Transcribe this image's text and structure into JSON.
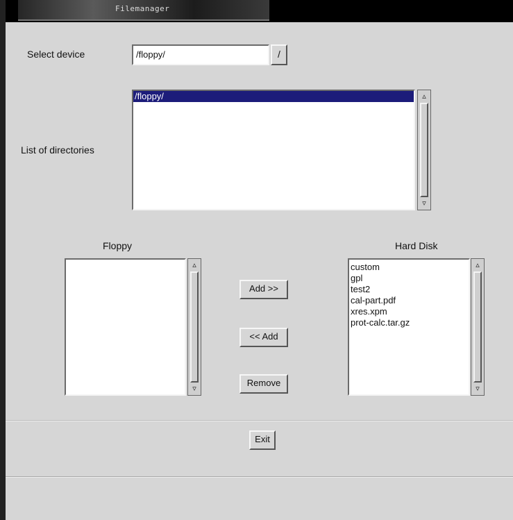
{
  "window": {
    "title": "Filemanager"
  },
  "device": {
    "label": "Select device",
    "value": "/floppy/",
    "button": "/"
  },
  "directories": {
    "label": "List of directories",
    "items": [
      "/floppy/"
    ],
    "selected_index": 0
  },
  "floppy": {
    "label": "Floppy",
    "items": []
  },
  "harddisk": {
    "label": "Hard Disk",
    "items": [
      "custom",
      "gpl",
      "test2",
      "cal-part.pdf",
      "xres.xpm",
      "prot-calc.tar.gz"
    ]
  },
  "buttons": {
    "add_right": "Add >>",
    "add_left": "<< Add",
    "remove": "Remove",
    "exit": "Exit"
  },
  "scroll": {
    "up": "▵",
    "down": "▿"
  }
}
